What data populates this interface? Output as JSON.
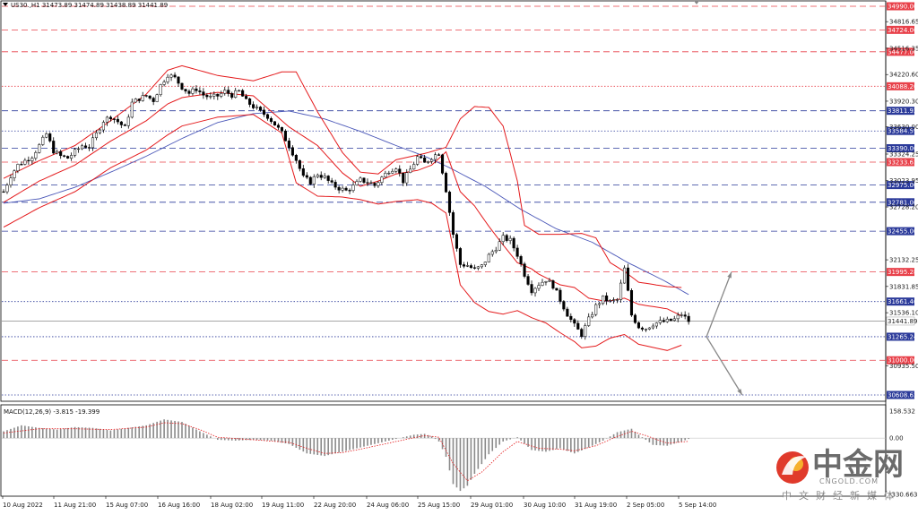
{
  "chart_data": [
    {
      "type": "candlestick",
      "symbol_header": "US30.,H1  31473.89 31474.89 31438.89 31441.89",
      "y_ticks": [
        "34816.65",
        "34516.35",
        "34220.60",
        "33920.30",
        "33630.00",
        "33324.25",
        "33023.95",
        "32728.20",
        "32132.25",
        "31831.85",
        "31536.10",
        "30935.50"
      ],
      "x_labels": [
        "10 Aug 2022",
        "11 Aug 21:00",
        "15 Aug 07:00",
        "16 Aug 16:00",
        "18 Aug 02:00",
        "19 Aug 11:00",
        "22 Aug 20:00",
        "24 Aug 06:00",
        "25 Aug 15:00",
        "29 Aug 01:00",
        "30 Aug 10:00",
        "31 Aug 19:00",
        "2 Sep 05:00",
        "5 Sep 14:00"
      ],
      "horizontal_levels": [
        {
          "value": 34990.0,
          "label": "34990.00",
          "color": "#e8414a",
          "style": "dashed",
          "labeled": true
        },
        {
          "value": 34724.0,
          "label": "34724.00",
          "color": "#e8414a",
          "style": "dashed",
          "labeled": true
        },
        {
          "value": 34477.0,
          "label": "34477.00",
          "color": "#e8414a",
          "style": "dashed",
          "labeled": true
        },
        {
          "value": 34088.2,
          "label": "34088.20",
          "color": "#e8414a",
          "style": "dotted",
          "labeled": true
        },
        {
          "value": 33811.92,
          "label": "33811.92",
          "color": "#2b3a9a",
          "style": "dashed",
          "labeled": true
        },
        {
          "value": 33584.59,
          "label": "33584.59",
          "color": "#2b3a9a",
          "style": "dotted",
          "labeled": true
        },
        {
          "value": 33390.0,
          "label": "33390.00",
          "color": "#2b3a9a",
          "style": "dashed",
          "labeled": true
        },
        {
          "value": 33233.63,
          "label": "33233.63",
          "color": "#e8414a",
          "style": "dashed",
          "labeled": true
        },
        {
          "value": 32975.0,
          "label": "32975.00",
          "color": "#2b3a9a",
          "style": "dashed",
          "labeled": true
        },
        {
          "value": 32781.0,
          "label": "32781.00",
          "color": "#2b3a9a",
          "style": "dashed",
          "labeled": true
        },
        {
          "value": 32455.0,
          "label": "32455.00",
          "color": "#2b3a9a",
          "style": "dashed",
          "labeled": true
        },
        {
          "value": 31995.28,
          "label": "31995.28",
          "color": "#e8414a",
          "style": "dashed",
          "labeled": true
        },
        {
          "value": 31661.46,
          "label": "31661.46",
          "color": "#2b3a9a",
          "style": "dotted",
          "labeled": true
        },
        {
          "value": 31441.89,
          "label": "31441.89",
          "color": "#999999",
          "style": "solid",
          "labeled": false
        },
        {
          "value": 31265.24,
          "label": "31265.24",
          "color": "#2b3a9a",
          "style": "dotted",
          "labeled": true
        },
        {
          "value": 31000.0,
          "label": "31000.00",
          "color": "#e8414a",
          "style": "dashed",
          "labeled": true
        },
        {
          "value": 30608.62,
          "label": "30608.62",
          "color": "#2b3a9a",
          "style": "dotted",
          "labeled": true
        }
      ],
      "current_price": "31441.89",
      "close_path": [
        [
          0,
          32900
        ],
        [
          2,
          33080
        ],
        [
          4,
          33200
        ],
        [
          6,
          33250
        ],
        [
          8,
          33300
        ],
        [
          10,
          33420
        ],
        [
          12,
          33550
        ],
        [
          14,
          33360
        ],
        [
          16,
          33300
        ],
        [
          18,
          33280
        ],
        [
          20,
          33350
        ],
        [
          22,
          33420
        ],
        [
          24,
          33410
        ],
        [
          26,
          33550
        ],
        [
          28,
          33700
        ],
        [
          30,
          33750
        ],
        [
          32,
          33690
        ],
        [
          34,
          33620
        ],
        [
          36,
          33900
        ],
        [
          38,
          33950
        ],
        [
          40,
          33980
        ],
        [
          42,
          33930
        ],
        [
          44,
          34100
        ],
        [
          46,
          34220
        ],
        [
          48,
          34180
        ],
        [
          50,
          34080
        ],
        [
          52,
          34010
        ],
        [
          54,
          34060
        ],
        [
          56,
          33990
        ],
        [
          58,
          33960
        ],
        [
          60,
          33980
        ],
        [
          62,
          34030
        ],
        [
          64,
          33990
        ],
        [
          66,
          34030
        ],
        [
          68,
          33920
        ],
        [
          70,
          33860
        ],
        [
          72,
          33800
        ],
        [
          74,
          33750
        ],
        [
          76,
          33660
        ],
        [
          78,
          33560
        ],
        [
          80,
          33420
        ],
        [
          82,
          33260
        ],
        [
          84,
          33060
        ],
        [
          86,
          33010
        ],
        [
          88,
          33100
        ],
        [
          90,
          33060
        ],
        [
          92,
          32980
        ],
        [
          94,
          32940
        ],
        [
          96,
          32910
        ],
        [
          98,
          32960
        ],
        [
          100,
          33030
        ],
        [
          102,
          33010
        ],
        [
          104,
          32970
        ],
        [
          106,
          33060
        ],
        [
          108,
          33140
        ],
        [
          110,
          33180
        ],
        [
          112,
          33020
        ],
        [
          114,
          33150
        ],
        [
          116,
          33290
        ],
        [
          118,
          33220
        ],
        [
          120,
          33290
        ],
        [
          122,
          33340
        ],
        [
          124,
          32920
        ],
        [
          126,
          32420
        ],
        [
          128,
          32080
        ],
        [
          130,
          32070
        ],
        [
          132,
          32020
        ],
        [
          134,
          32060
        ],
        [
          136,
          32180
        ],
        [
          138,
          32270
        ],
        [
          140,
          32380
        ],
        [
          142,
          32350
        ],
        [
          144,
          32190
        ],
        [
          146,
          31970
        ],
        [
          148,
          31790
        ],
        [
          150,
          31860
        ],
        [
          152,
          31910
        ],
        [
          154,
          31840
        ],
        [
          156,
          31680
        ],
        [
          158,
          31520
        ],
        [
          160,
          31390
        ],
        [
          162,
          31290
        ],
        [
          164,
          31460
        ],
        [
          166,
          31610
        ],
        [
          168,
          31700
        ],
        [
          170,
          31660
        ],
        [
          172,
          31680
        ],
        [
          174,
          32030
        ],
        [
          176,
          31510
        ],
        [
          178,
          31380
        ],
        [
          180,
          31360
        ],
        [
          182,
          31410
        ],
        [
          184,
          31430
        ],
        [
          186,
          31440
        ],
        [
          188,
          31460
        ],
        [
          190,
          31520
        ],
        [
          192,
          31441.89
        ]
      ],
      "ma_blue_path": [
        [
          0,
          32770
        ],
        [
          10,
          32820
        ],
        [
          20,
          32950
        ],
        [
          30,
          33120
        ],
        [
          40,
          33300
        ],
        [
          50,
          33500
        ],
        [
          60,
          33680
        ],
        [
          70,
          33780
        ],
        [
          80,
          33810
        ],
        [
          90,
          33720
        ],
        [
          100,
          33580
        ],
        [
          110,
          33420
        ],
        [
          118,
          33300
        ],
        [
          125,
          33170
        ],
        [
          135,
          32960
        ],
        [
          145,
          32700
        ],
        [
          155,
          32480
        ],
        [
          165,
          32330
        ],
        [
          175,
          32100
        ],
        [
          185,
          31900
        ],
        [
          192,
          31740
        ]
      ],
      "bb_upper_path": [
        [
          0,
          33050
        ],
        [
          10,
          33250
        ],
        [
          20,
          33420
        ],
        [
          30,
          33700
        ],
        [
          40,
          34000
        ],
        [
          46,
          34270
        ],
        [
          50,
          34320
        ],
        [
          60,
          34210
        ],
        [
          70,
          34150
        ],
        [
          78,
          34250
        ],
        [
          82,
          34250
        ],
        [
          88,
          33800
        ],
        [
          95,
          33340
        ],
        [
          100,
          33120
        ],
        [
          105,
          33100
        ],
        [
          110,
          33260
        ],
        [
          118,
          33330
        ],
        [
          124,
          33400
        ],
        [
          128,
          33720
        ],
        [
          132,
          33860
        ],
        [
          136,
          33850
        ],
        [
          140,
          33640
        ],
        [
          144,
          33020
        ],
        [
          146,
          32520
        ],
        [
          150,
          32420
        ],
        [
          156,
          32420
        ],
        [
          162,
          32430
        ],
        [
          166,
          32380
        ],
        [
          170,
          32100
        ],
        [
          174,
          32000
        ],
        [
          178,
          31880
        ],
        [
          186,
          31830
        ],
        [
          190,
          31820
        ]
      ],
      "bb_middle_path": [
        [
          0,
          32780
        ],
        [
          10,
          33020
        ],
        [
          20,
          33200
        ],
        [
          30,
          33470
        ],
        [
          40,
          33700
        ],
        [
          46,
          33890
        ],
        [
          50,
          33960
        ],
        [
          60,
          34020
        ],
        [
          70,
          33980
        ],
        [
          80,
          33630
        ],
        [
          88,
          33420
        ],
        [
          95,
          33110
        ],
        [
          100,
          32960
        ],
        [
          105,
          33020
        ],
        [
          110,
          33100
        ],
        [
          116,
          33140
        ],
        [
          120,
          33200
        ],
        [
          124,
          33350
        ],
        [
          128,
          32900
        ],
        [
          132,
          32740
        ],
        [
          136,
          32510
        ],
        [
          140,
          32300
        ],
        [
          144,
          32100
        ],
        [
          148,
          32030
        ],
        [
          150,
          31970
        ],
        [
          156,
          31850
        ],
        [
          160,
          31820
        ],
        [
          164,
          31700
        ],
        [
          168,
          31670
        ],
        [
          170,
          31670
        ],
        [
          174,
          31700
        ],
        [
          178,
          31630
        ],
        [
          186,
          31580
        ],
        [
          190,
          31500
        ]
      ],
      "bb_lower_path": [
        [
          0,
          32500
        ],
        [
          10,
          32720
        ],
        [
          20,
          32900
        ],
        [
          30,
          33170
        ],
        [
          40,
          33370
        ],
        [
          46,
          33540
        ],
        [
          50,
          33640
        ],
        [
          60,
          33740
        ],
        [
          70,
          33770
        ],
        [
          78,
          33560
        ],
        [
          82,
          33000
        ],
        [
          88,
          32850
        ],
        [
          95,
          32840
        ],
        [
          100,
          32810
        ],
        [
          105,
          32760
        ],
        [
          110,
          32790
        ],
        [
          116,
          32810
        ],
        [
          120,
          32770
        ],
        [
          124,
          32660
        ],
        [
          128,
          31850
        ],
        [
          132,
          31650
        ],
        [
          136,
          31550
        ],
        [
          140,
          31520
        ],
        [
          144,
          31560
        ],
        [
          148,
          31480
        ],
        [
          152,
          31420
        ],
        [
          156,
          31310
        ],
        [
          160,
          31210
        ],
        [
          162,
          31140
        ],
        [
          166,
          31160
        ],
        [
          170,
          31250
        ],
        [
          174,
          31290
        ],
        [
          178,
          31180
        ],
        [
          186,
          31110
        ],
        [
          190,
          31170
        ]
      ],
      "projection_arrows": [
        {
          "from_x": 197,
          "from_y": 31265.24,
          "to_x": 204,
          "to_y": 31995.28,
          "color": "#888888"
        },
        {
          "from_x": 197,
          "from_y": 31265.24,
          "to_x": 207,
          "to_y": 30608.62,
          "color": "#888888"
        }
      ]
    },
    {
      "type": "histogram",
      "title": "MACD(12,26,9) -3.815 -19.399",
      "y_ticks": [
        "158.532",
        "0.00",
        "-330.663"
      ],
      "ylim": [
        -330.663,
        158.532
      ],
      "histogram_path": [
        [
          0,
          40
        ],
        [
          5,
          75
        ],
        [
          10,
          60
        ],
        [
          15,
          50
        ],
        [
          20,
          65
        ],
        [
          25,
          60
        ],
        [
          30,
          45
        ],
        [
          35,
          60
        ],
        [
          40,
          75
        ],
        [
          45,
          110
        ],
        [
          50,
          95
        ],
        [
          55,
          40
        ],
        [
          60,
          -10
        ],
        [
          65,
          -15
        ],
        [
          70,
          -10
        ],
        [
          75,
          -15
        ],
        [
          80,
          -35
        ],
        [
          85,
          -90
        ],
        [
          90,
          -105
        ],
        [
          95,
          -80
        ],
        [
          100,
          -55
        ],
        [
          105,
          -30
        ],
        [
          110,
          -5
        ],
        [
          115,
          20
        ],
        [
          118,
          25
        ],
        [
          120,
          10
        ],
        [
          122,
          -20
        ],
        [
          124,
          -110
        ],
        [
          126,
          -270
        ],
        [
          128,
          -310
        ],
        [
          130,
          -280
        ],
        [
          132,
          -210
        ],
        [
          136,
          -95
        ],
        [
          140,
          -20
        ],
        [
          144,
          5
        ],
        [
          148,
          -70
        ],
        [
          152,
          -80
        ],
        [
          156,
          -60
        ],
        [
          160,
          -90
        ],
        [
          164,
          -55
        ],
        [
          168,
          -15
        ],
        [
          172,
          35
        ],
        [
          176,
          55
        ],
        [
          178,
          20
        ],
        [
          182,
          -40
        ],
        [
          186,
          -45
        ],
        [
          190,
          -20
        ],
        [
          192,
          -5
        ]
      ],
      "signal_path": [
        [
          0,
          30
        ],
        [
          10,
          55
        ],
        [
          20,
          55
        ],
        [
          30,
          50
        ],
        [
          40,
          65
        ],
        [
          45,
          90
        ],
        [
          50,
          85
        ],
        [
          55,
          50
        ],
        [
          60,
          5
        ],
        [
          70,
          -10
        ],
        [
          80,
          -25
        ],
        [
          85,
          -60
        ],
        [
          90,
          -90
        ],
        [
          95,
          -85
        ],
        [
          100,
          -65
        ],
        [
          110,
          -20
        ],
        [
          118,
          15
        ],
        [
          122,
          5
        ],
        [
          126,
          -150
        ],
        [
          130,
          -250
        ],
        [
          134,
          -200
        ],
        [
          140,
          -80
        ],
        [
          144,
          -20
        ],
        [
          150,
          -60
        ],
        [
          156,
          -65
        ],
        [
          160,
          -75
        ],
        [
          166,
          -45
        ],
        [
          172,
          10
        ],
        [
          176,
          40
        ],
        [
          180,
          15
        ],
        [
          186,
          -30
        ],
        [
          192,
          -19
        ]
      ]
    }
  ],
  "watermark": {
    "brand_cn": "中金网",
    "url": "CNGOLD.COM",
    "sub_cn": "中文财经新媒体"
  }
}
